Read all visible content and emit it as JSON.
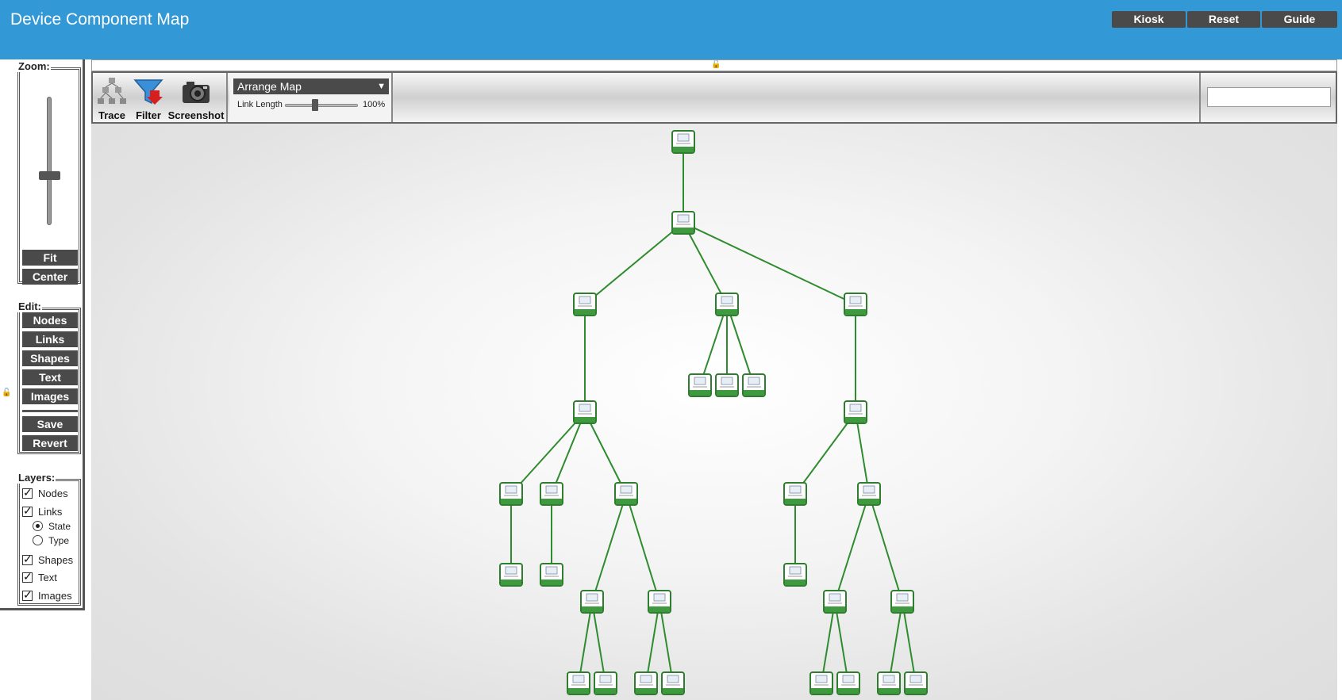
{
  "header": {
    "title": "Device Component Map",
    "kiosk_label": "Kiosk",
    "reset_label": "Reset",
    "guide_label": "Guide",
    "color": "#3399d6"
  },
  "left_panel": {
    "zoom_legend": "Zoom:",
    "fit_label": "Fit",
    "center_label": "Center",
    "edit_legend": "Edit:",
    "edit_buttons": [
      "Nodes",
      "Links",
      "Shapes",
      "Text",
      "Images"
    ],
    "save_label": "Save",
    "revert_label": "Revert",
    "layers_legend": "Layers:",
    "layers": {
      "nodes": "Nodes",
      "links": "Links",
      "state": "State",
      "type": "Type",
      "shapes": "Shapes",
      "text": "Text",
      "images": "Images"
    },
    "links_mode_selected": "State",
    "zoom_level_fraction": 0.55
  },
  "toolbar": {
    "trace_label": "Trace",
    "filter_label": "Filter",
    "screenshot_label": "Screenshot",
    "arrange_select": "Arrange Map",
    "link_length_label": "Link Length",
    "link_length_value": "100%",
    "link_length_fraction": 0.45,
    "search_value": "",
    "lock_icon": "lock-icon"
  },
  "map": {
    "link_color": "#2e8b2e",
    "node_border_color": "#2f7d2f",
    "node_count": 31
  }
}
